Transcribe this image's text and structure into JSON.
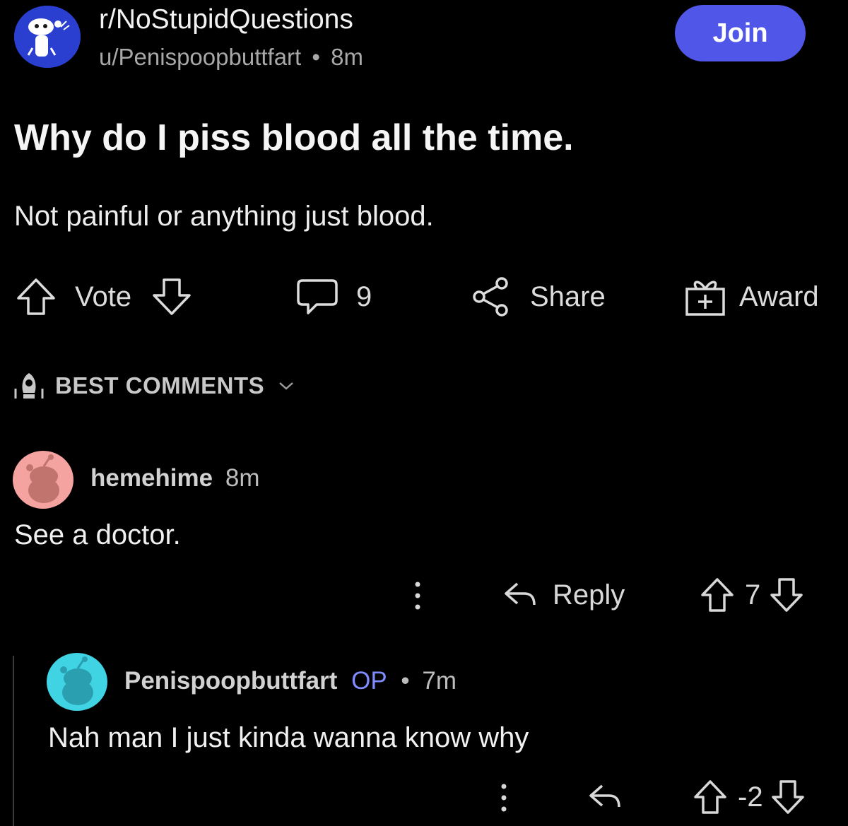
{
  "header": {
    "subreddit": "r/NoStupidQuestions",
    "author": "u/Penispoopbuttfart",
    "separator": "•",
    "age": "8m",
    "join_label": "Join"
  },
  "post": {
    "title": "Why do I piss blood all the time.",
    "body": "Not painful or anything just blood."
  },
  "actions": {
    "vote_label": "Vote",
    "comment_count": "9",
    "share_label": "Share",
    "award_label": "Award"
  },
  "sort": {
    "label": "BEST COMMENTS"
  },
  "comments": [
    {
      "user": "hemehime",
      "age": "8m",
      "text": "See a doctor.",
      "reply_label": "Reply",
      "score": "7",
      "avatar_color": "#f4a3a0"
    },
    {
      "user": "Penispoopbuttfart",
      "op_label": "OP",
      "separator": "•",
      "age": "7m",
      "text": "Nah man I just kinda wanna know why",
      "score": "-2",
      "avatar_color": "#3fd3e3"
    }
  ],
  "colors": {
    "background": "#000000",
    "join_button": "#4f56e8",
    "op_accent": "#7f8bff",
    "subreddit_avatar": "#2a3fd0"
  }
}
